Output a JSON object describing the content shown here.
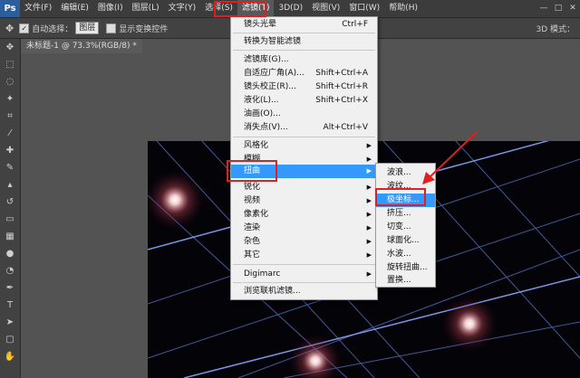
{
  "app_logo": "Ps",
  "menubar": {
    "items": [
      "文件(F)",
      "编辑(E)",
      "图像(I)",
      "图层(L)",
      "文字(Y)",
      "选择(S)",
      "滤镜(T)",
      "3D(D)",
      "视图(V)",
      "窗口(W)",
      "帮助(H)"
    ],
    "window_controls": [
      "—",
      "□",
      "✕"
    ]
  },
  "options_bar": {
    "auto_select_label": "自动选择：",
    "auto_select_value": "图层",
    "show_transform_label": "显示变换控件",
    "mode_3d_label": "3D 模式："
  },
  "document_tab": "未标题-1 @ 73.3%(RGB/8) *",
  "filter_menu": {
    "items": [
      {
        "label": "镜头光晕",
        "shortcut": "Ctrl+F"
      },
      {
        "label": "转换为智能滤镜",
        "shortcut": ""
      },
      {
        "label": "滤镜库(G)...",
        "shortcut": ""
      },
      {
        "label": "自适应广角(A)...",
        "shortcut": "Shift+Ctrl+A"
      },
      {
        "label": "镜头校正(R)...",
        "shortcut": "Shift+Ctrl+R"
      },
      {
        "label": "液化(L)...",
        "shortcut": "Shift+Ctrl+X"
      },
      {
        "label": "油画(O)...",
        "shortcut": ""
      },
      {
        "label": "消失点(V)...",
        "shortcut": "Alt+Ctrl+V"
      },
      {
        "label": "风格化",
        "shortcut": ""
      },
      {
        "label": "模糊",
        "shortcut": ""
      },
      {
        "label": "扭曲",
        "shortcut": ""
      },
      {
        "label": "锐化",
        "shortcut": ""
      },
      {
        "label": "视频",
        "shortcut": ""
      },
      {
        "label": "像素化",
        "shortcut": ""
      },
      {
        "label": "渲染",
        "shortcut": ""
      },
      {
        "label": "杂色",
        "shortcut": ""
      },
      {
        "label": "其它",
        "shortcut": ""
      },
      {
        "label": "Digimarc",
        "shortcut": ""
      },
      {
        "label": "浏览联机滤镜...",
        "shortcut": ""
      }
    ],
    "submenu_arrow": "▶"
  },
  "distort_submenu": {
    "items": [
      "波浪...",
      "波纹...",
      "极坐标...",
      "挤压...",
      "切变...",
      "球面化...",
      "水波...",
      "旋转扭曲...",
      "置换..."
    ]
  },
  "colors": {
    "highlight": "#3399ff",
    "annotation_red": "#e02020"
  }
}
